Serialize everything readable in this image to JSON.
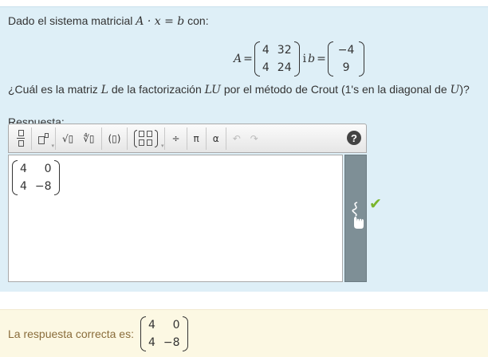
{
  "question": {
    "intro_text": "Dado el sistema matricial",
    "intro_formula": "A · x = b",
    "intro_suffix": "con:",
    "matrix_A_name": "A",
    "matrix_A": [
      [
        "4",
        "32"
      ],
      [
        "4",
        "24"
      ]
    ],
    "conjunction": "i",
    "vector_b_name": "b",
    "vector_b": [
      "−4",
      "9"
    ],
    "prompt_start": "¿Cuál es la matriz",
    "prompt_L": "L",
    "prompt_mid": "de la factorización",
    "prompt_LU": "LU",
    "prompt_mid2": "por el método de Crout (1's en la diagonal de",
    "prompt_U": "U",
    "prompt_end": ")?"
  },
  "answer": {
    "label": "Respuesta:",
    "entered_matrix": [
      [
        "4",
        "0"
      ],
      [
        "4",
        "−8"
      ]
    ],
    "status": "correct"
  },
  "toolbar": {
    "buttons": [
      {
        "name": "fraction-icon"
      },
      {
        "name": "superscript-icon"
      },
      {
        "name": "sqrt-icon",
        "glyph": "√▯"
      },
      {
        "name": "nth-root-icon",
        "glyph": "∜▯"
      },
      {
        "name": "parentheses-icon",
        "glyph": "(▯)"
      },
      {
        "name": "matrix-icon"
      },
      {
        "name": "division-icon",
        "glyph": "÷"
      },
      {
        "name": "pi-icon",
        "glyph": "π"
      },
      {
        "name": "alpha-icon",
        "glyph": "α"
      },
      {
        "name": "undo-icon",
        "glyph": "↶"
      },
      {
        "name": "redo-icon",
        "glyph": "↷"
      }
    ],
    "help_label": "?"
  },
  "feedback": {
    "label": "La respuesta correcta es:",
    "correct_matrix": [
      [
        "4",
        "0"
      ],
      [
        "4",
        "−8"
      ]
    ]
  },
  "colors": {
    "question_bg": "#deeff7",
    "feedback_bg": "#fcf8e3",
    "feedback_text": "#8a6d3b",
    "check": "#7ab52d",
    "handwrite_bar": "#7e8f96"
  }
}
